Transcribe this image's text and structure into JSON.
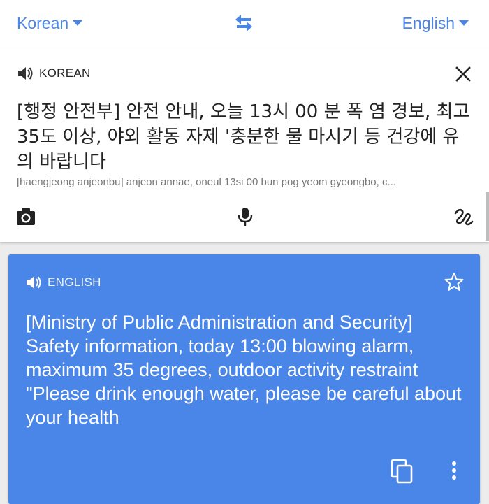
{
  "language_bar": {
    "source_language": "Korean",
    "target_language": "English",
    "swap_icon": "swap-arrows-icon",
    "accent_color": "#4a86e8"
  },
  "input_card": {
    "language_label": "KOREAN",
    "source_text": "[행정 안전부] 안전 안내, 오늘 13시 00 분 폭 염 경보, 최고 35도 이상, 야외 활동 자제 '충분한 물 마시기 등 건강에 유의 바랍니다",
    "transliteration": "[haengjeong anjeonbu] anjeon annae, oneul 13si 00 bun pog yeom gyeongbo, c...",
    "icons": [
      "speaker-icon",
      "close-icon",
      "camera-icon",
      "microphone-icon",
      "handwriting-icon"
    ]
  },
  "output_card": {
    "language_label": "ENGLISH",
    "translation": "[Ministry of Public Administration and Security] Safety information, today 13:00 blowing alarm, maximum 35 degrees, outdoor activity restraint \"Please drink enough water, please be careful about your health",
    "background_color": "#4a86e8",
    "icons": [
      "speaker-icon",
      "star-icon",
      "copy-icon",
      "more-vert-icon"
    ]
  }
}
